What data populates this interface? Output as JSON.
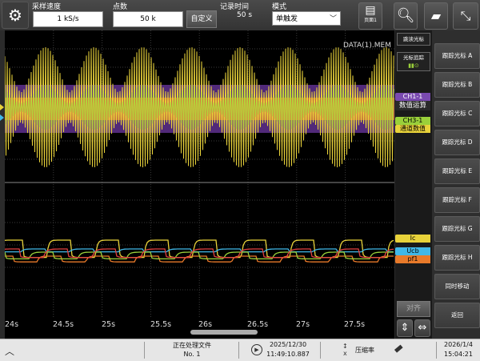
{
  "toolbar": {
    "sampling_rate_label": "采样速度",
    "sampling_rate_value": "1 kS/s",
    "points_label": "点数",
    "points_value": "50 k",
    "custom_button": "自定义",
    "record_time_label": "记录时间",
    "record_time_value": "50 s",
    "mode_label": "模式",
    "mode_value": "单触发",
    "page_button": "页面1"
  },
  "plot": {
    "file_label": "DATA(1).MEM",
    "x_ticks": [
      "24s",
      "24.5s",
      "25s",
      "25.5s",
      "26s",
      "26.5s",
      "27s",
      "27.5s"
    ],
    "upper_overlay": [
      "CH1-1",
      "数值运算",
      "CH3-1",
      "通道数值"
    ],
    "lower_tags": [
      "Ic",
      "Ucb",
      "pf1"
    ]
  },
  "right_col": {
    "cursor_track": "跳读光标",
    "cursor_search": "光标追踪",
    "align_button": "对齐"
  },
  "sidebar": {
    "items": [
      "跟踪光标 A",
      "跟踪光标 B",
      "跟踪光标 C",
      "跟踪光标 D",
      "跟踪光标 E",
      "跟踪光标 F",
      "跟踪光标 G",
      "跟踪光标 H",
      "同时移动",
      "返回"
    ]
  },
  "status": {
    "processing": "正在处理文件",
    "number": "No. 1",
    "play_date": "2025/12/30",
    "play_time": "11:49:10.887",
    "compress_label": "压缩率",
    "clock_date": "2026/1/4",
    "clock_time": "15:04:21"
  },
  "colors": {
    "ch_yellow": "#e8d23a",
    "ch_purple": "#6b3fa0",
    "ch_orange": "#e87a2a",
    "ch_green": "#9ad03a",
    "ch_cyan": "#40b8e8",
    "ch_red": "#e04040"
  }
}
